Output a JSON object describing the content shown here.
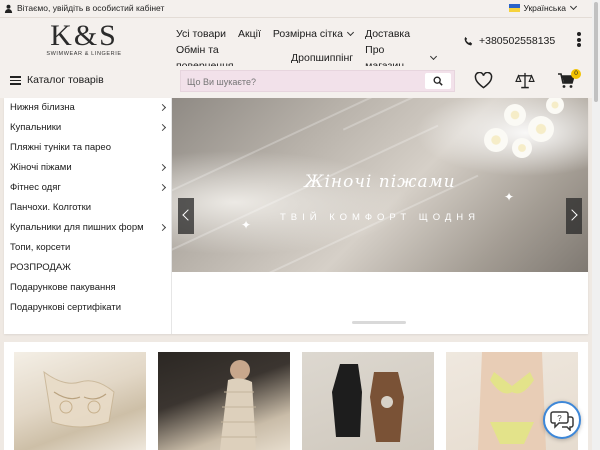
{
  "topbar": {
    "login_text": "Вітаємо, увійдіть в особистий кабінет",
    "language": "Українська"
  },
  "logo": {
    "mark": "K&S",
    "tagline": "SWIMWEAR & LINGERIE"
  },
  "nav": {
    "row1": [
      "Усі товари",
      "Акції",
      "Розмірна сітка",
      "Доставка"
    ],
    "row2": [
      "Обмін та повернення",
      "Дропшиппінг",
      "Про магазин"
    ]
  },
  "header": {
    "phone": "+380502558135"
  },
  "search": {
    "catalog_label": "Каталог товарів",
    "placeholder": "Що Ви шукаєте?",
    "cart_count": "0"
  },
  "menu": {
    "items": [
      "Нижня білизна",
      "Купальники",
      "Пляжні туніки та парео",
      "Жіночі піжами",
      "Фітнес одяг",
      "Панчохи. Колготки",
      "Купальники для пишних форм",
      "Топи, корсети",
      "РОЗПРОДАЖ",
      "Подарункове пакування",
      "Подарункові сертифікати"
    ]
  },
  "banner": {
    "title": "Жіночі піжами",
    "tagline": "ТВІЙ КОМФОРТ ЩОДНЯ"
  },
  "colors": {
    "page_bg": "#efe9e3",
    "search_bg": "#f2e1ea",
    "badge": "#f2c200",
    "chat_ring": "#3d87d8"
  }
}
